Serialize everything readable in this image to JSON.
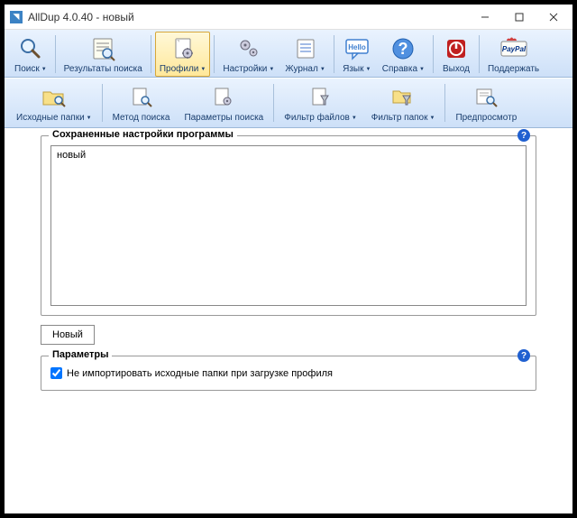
{
  "title": "AllDup 4.0.40 - новый",
  "toolbar_main": {
    "search": "Поиск",
    "results": "Результаты поиска",
    "profiles": "Профили",
    "settings": "Настройки",
    "log": "Журнал",
    "language": "Язык",
    "help": "Справка",
    "exit": "Выход",
    "support": "Поддержать"
  },
  "toolbar_sub": {
    "source_folders": "Исходные папки",
    "search_method": "Метод поиска",
    "search_params": "Параметры поиска",
    "file_filter": "Фильтр файлов",
    "folder_filter": "Фильтр папок",
    "preview": "Предпросмотр"
  },
  "profiles_section": {
    "legend": "Сохраненные настройки программы",
    "item": "новый",
    "new_button": "Новый"
  },
  "params_section": {
    "legend": "Параметры",
    "checkbox_label": "Не импортировать исходные папки при загрузке профиля",
    "checked": true
  }
}
